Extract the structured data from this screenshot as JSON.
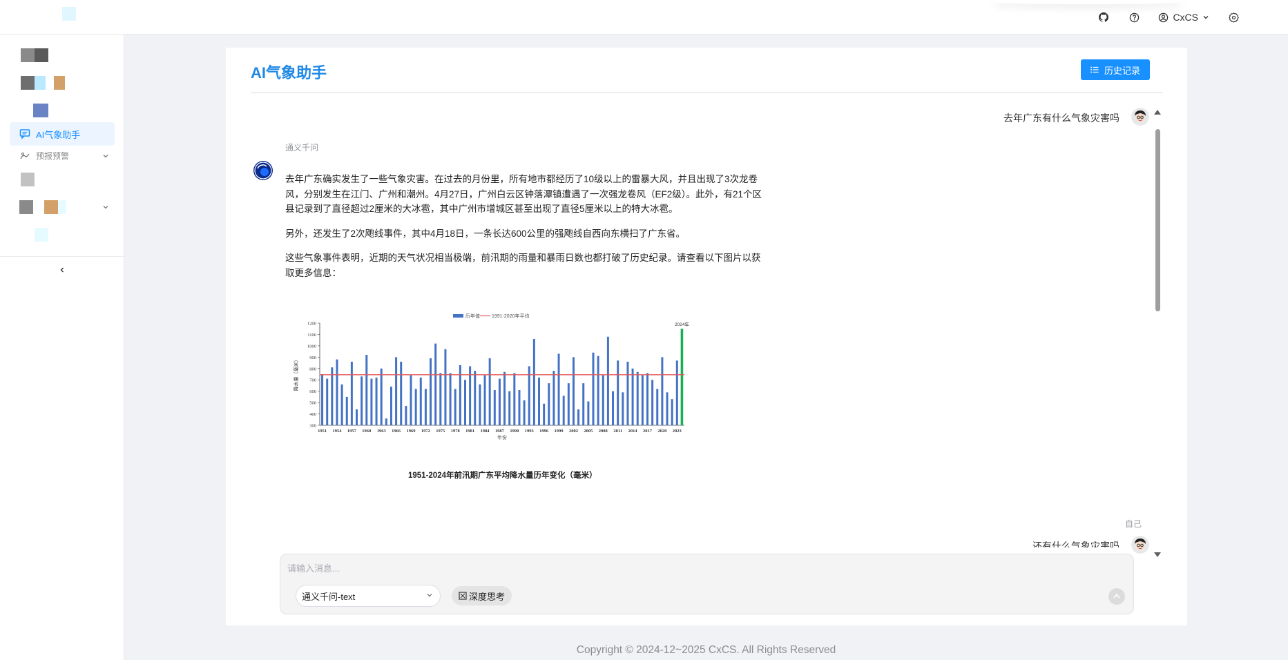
{
  "header": {
    "username": "CxCS",
    "icons": [
      "github-icon",
      "help-circle-icon",
      "user-circle-icon",
      "chevron-down-icon",
      "settings-icon"
    ]
  },
  "sidebar": {
    "active_item": {
      "label": "AI气象助手",
      "icon": "chat-bubble-icon",
      "color": "#1890ff"
    },
    "items": [
      {
        "label": "预报预警",
        "icon": "weather-icon",
        "has_children": true
      }
    ]
  },
  "page": {
    "title": "AI气象助手",
    "title_color": "#1e88e5",
    "history_button": "历史记录",
    "accent": "#1890ff"
  },
  "chat": {
    "messages": [
      {
        "role": "user",
        "text": "去年广东有什么气象灾害吗"
      },
      {
        "role": "assistant",
        "name": "通义千问",
        "paragraphs": [
          "去年广东确实发生了一些气象灾害。在过去的月份里，所有地市都经历了10级以上的雷暴大风，并且出现了3次龙卷风，分别发生在江门、广州和潮州。4月27日，广州白云区钟落潭镇遭遇了一次强龙卷风（EF2级）。此外，有21个区县记录到了直径超过2厘米的大冰雹，其中广州市增城区甚至出现了直径5厘米以上的特大冰雹。",
          "另外，还发生了2次飑线事件，其中4月18日，一条长达600公里的强飑线自西向东横扫了广东省。",
          "这些气象事件表明，近期的天气状况相当极端，前汛期的雨量和暴雨日数也都打破了历史纪录。请查看以下图片以获取更多信息："
        ]
      },
      {
        "role": "user",
        "name": "自己",
        "text": "还有什么气象灾害吗"
      }
    ]
  },
  "chart_data": {
    "type": "bar",
    "title": "1951-2024年前汛期广东平均降水量历年变化（毫米）",
    "xlabel": "年份",
    "ylabel": "降水量（毫米）",
    "ylim": [
      300,
      1200
    ],
    "yticks": [
      300,
      400,
      500,
      600,
      700,
      800,
      900,
      1000,
      1100,
      1200
    ],
    "xticks": [
      "1951",
      "1954",
      "1957",
      "1960",
      "1963",
      "1966",
      "1969",
      "1972",
      "1975",
      "1978",
      "1981",
      "1984",
      "1987",
      "1990",
      "1993",
      "1996",
      "1999",
      "2002",
      "2005",
      "2008",
      "2011",
      "2014",
      "2017",
      "2020",
      "2023"
    ],
    "legend": [
      "历年值",
      "1991-2020年平均"
    ],
    "legend_position": "top-center",
    "annotation": "2024年",
    "x": [
      1951,
      1952,
      1953,
      1954,
      1955,
      1956,
      1957,
      1958,
      1959,
      1960,
      1961,
      1962,
      1963,
      1964,
      1965,
      1966,
      1967,
      1968,
      1969,
      1970,
      1971,
      1972,
      1973,
      1974,
      1975,
      1976,
      1977,
      1978,
      1979,
      1980,
      1981,
      1982,
      1983,
      1984,
      1985,
      1986,
      1987,
      1988,
      1989,
      1990,
      1991,
      1992,
      1993,
      1994,
      1995,
      1996,
      1997,
      1998,
      1999,
      2000,
      2001,
      2002,
      2003,
      2004,
      2005,
      2006,
      2007,
      2008,
      2009,
      2010,
      2011,
      2012,
      2013,
      2014,
      2015,
      2016,
      2017,
      2018,
      2019,
      2020,
      2021,
      2022,
      2023,
      2024
    ],
    "series": [
      {
        "name": "历年值",
        "color": "#4472c4",
        "values": [
          750,
          710,
          810,
          880,
          660,
          550,
          860,
          440,
          730,
          920,
          710,
          720,
          800,
          360,
          640,
          900,
          860,
          470,
          740,
          620,
          720,
          620,
          890,
          1020,
          760,
          970,
          760,
          620,
          830,
          700,
          820,
          780,
          660,
          740,
          890,
          610,
          710,
          770,
          600,
          760,
          610,
          520,
          820,
          1060,
          720,
          490,
          670,
          780,
          930,
          560,
          670,
          900,
          440,
          670,
          510,
          940,
          910,
          740,
          1080,
          600,
          870,
          590,
          860,
          800,
          770,
          740,
          760,
          700,
          620,
          900,
          590,
          530,
          870,
          590
        ]
      },
      {
        "name": "2024年",
        "color": "#1aaf54",
        "values": [
          null,
          null,
          null,
          null,
          null,
          null,
          null,
          null,
          null,
          null,
          null,
          null,
          null,
          null,
          null,
          null,
          null,
          null,
          null,
          null,
          null,
          null,
          null,
          null,
          null,
          null,
          null,
          null,
          null,
          null,
          null,
          null,
          null,
          null,
          null,
          null,
          null,
          null,
          null,
          null,
          null,
          null,
          null,
          null,
          null,
          null,
          null,
          null,
          null,
          null,
          null,
          null,
          null,
          null,
          null,
          null,
          null,
          null,
          null,
          null,
          null,
          null,
          null,
          null,
          null,
          null,
          null,
          null,
          null,
          null,
          null,
          null,
          null,
          1150
        ]
      }
    ],
    "reference_line": {
      "name": "1991-2020年平均",
      "value": 745,
      "color": "#e15759"
    }
  },
  "input": {
    "placeholder": "请输入消息...",
    "model": "通义千问-text",
    "deep_think": "深度思考"
  },
  "footer": {
    "copyright": "Copyright © 2024-12~2025 CxCS. All Rights Reserved"
  }
}
